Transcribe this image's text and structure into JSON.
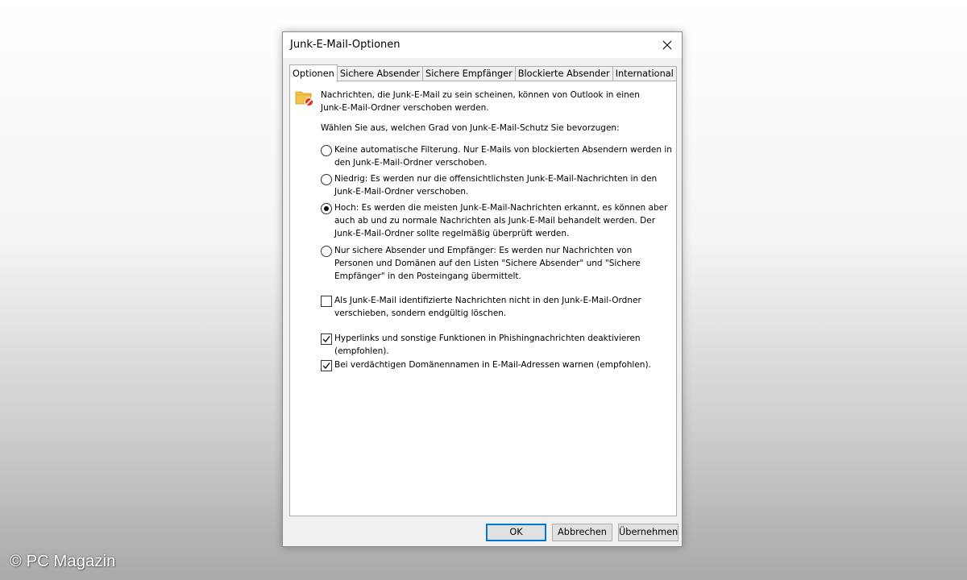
{
  "dialog": {
    "title": "Junk-E-Mail-Optionen",
    "tabs": [
      {
        "label": "Optionen",
        "active": true
      },
      {
        "label": "Sichere Absender",
        "active": false
      },
      {
        "label": "Sichere Empfänger",
        "active": false
      },
      {
        "label": "Blockierte Absender",
        "active": false
      },
      {
        "label": "International",
        "active": false
      }
    ],
    "intro_text": "Nachrichten, die Junk-E-Mail zu sein scheinen, können von Outlook in einen Junk-E-Mail-Ordner verschoben werden.",
    "protection_prompt": "Wählen Sie aus, welchen Grad von Junk-E-Mail-Schutz Sie bevorzugen:",
    "protection_levels": [
      {
        "label": "Keine automatische Filterung. Nur E-Mails von blockierten Absendern werden in den Junk-E-Mail-Ordner verschoben.",
        "selected": false
      },
      {
        "label": "Niedrig: Es werden nur die offensichtlichsten Junk-E-Mail-Nachrichten in den Junk-E-Mail-Ordner verschoben.",
        "selected": false
      },
      {
        "label": "Hoch: Es werden die meisten Junk-E-Mail-Nachrichten erkannt, es können aber auch ab und zu normale Nachrichten als Junk-E-Mail behandelt werden. Der Junk-E-Mail-Ordner sollte regelmäßig überprüft werden.",
        "selected": true
      },
      {
        "label": "Nur sichere Absender und Empfänger: Es werden nur Nachrichten von Personen und Domänen auf den Listen \"Sichere Absender\" und \"Sichere Empfänger\" in den Posteingang übermittelt.",
        "selected": false
      }
    ],
    "checkboxes": [
      {
        "label": "Als Junk-E-Mail identifizierte Nachrichten nicht in den Junk-E-Mail-Ordner verschieben, sondern endgültig löschen.",
        "checked": false
      },
      {
        "label": "Hyperlinks und sonstige Funktionen in Phishingnachrichten deaktivieren (empfohlen).",
        "checked": true
      },
      {
        "label": "Bei verdächtigen Domänennamen in E-Mail-Adressen warnen (empfohlen).",
        "checked": true
      }
    ],
    "buttons": {
      "ok": "OK",
      "cancel": "Abbrechen",
      "apply": "Übernehmen"
    },
    "icons": {
      "close": "close-icon",
      "junk_folder": "junk-folder-icon"
    }
  },
  "watermark": "© PC Magazin",
  "colors": {
    "accent": "#0078d7",
    "icon_folder": "#f2c54b",
    "icon_block": "#e0322b"
  }
}
